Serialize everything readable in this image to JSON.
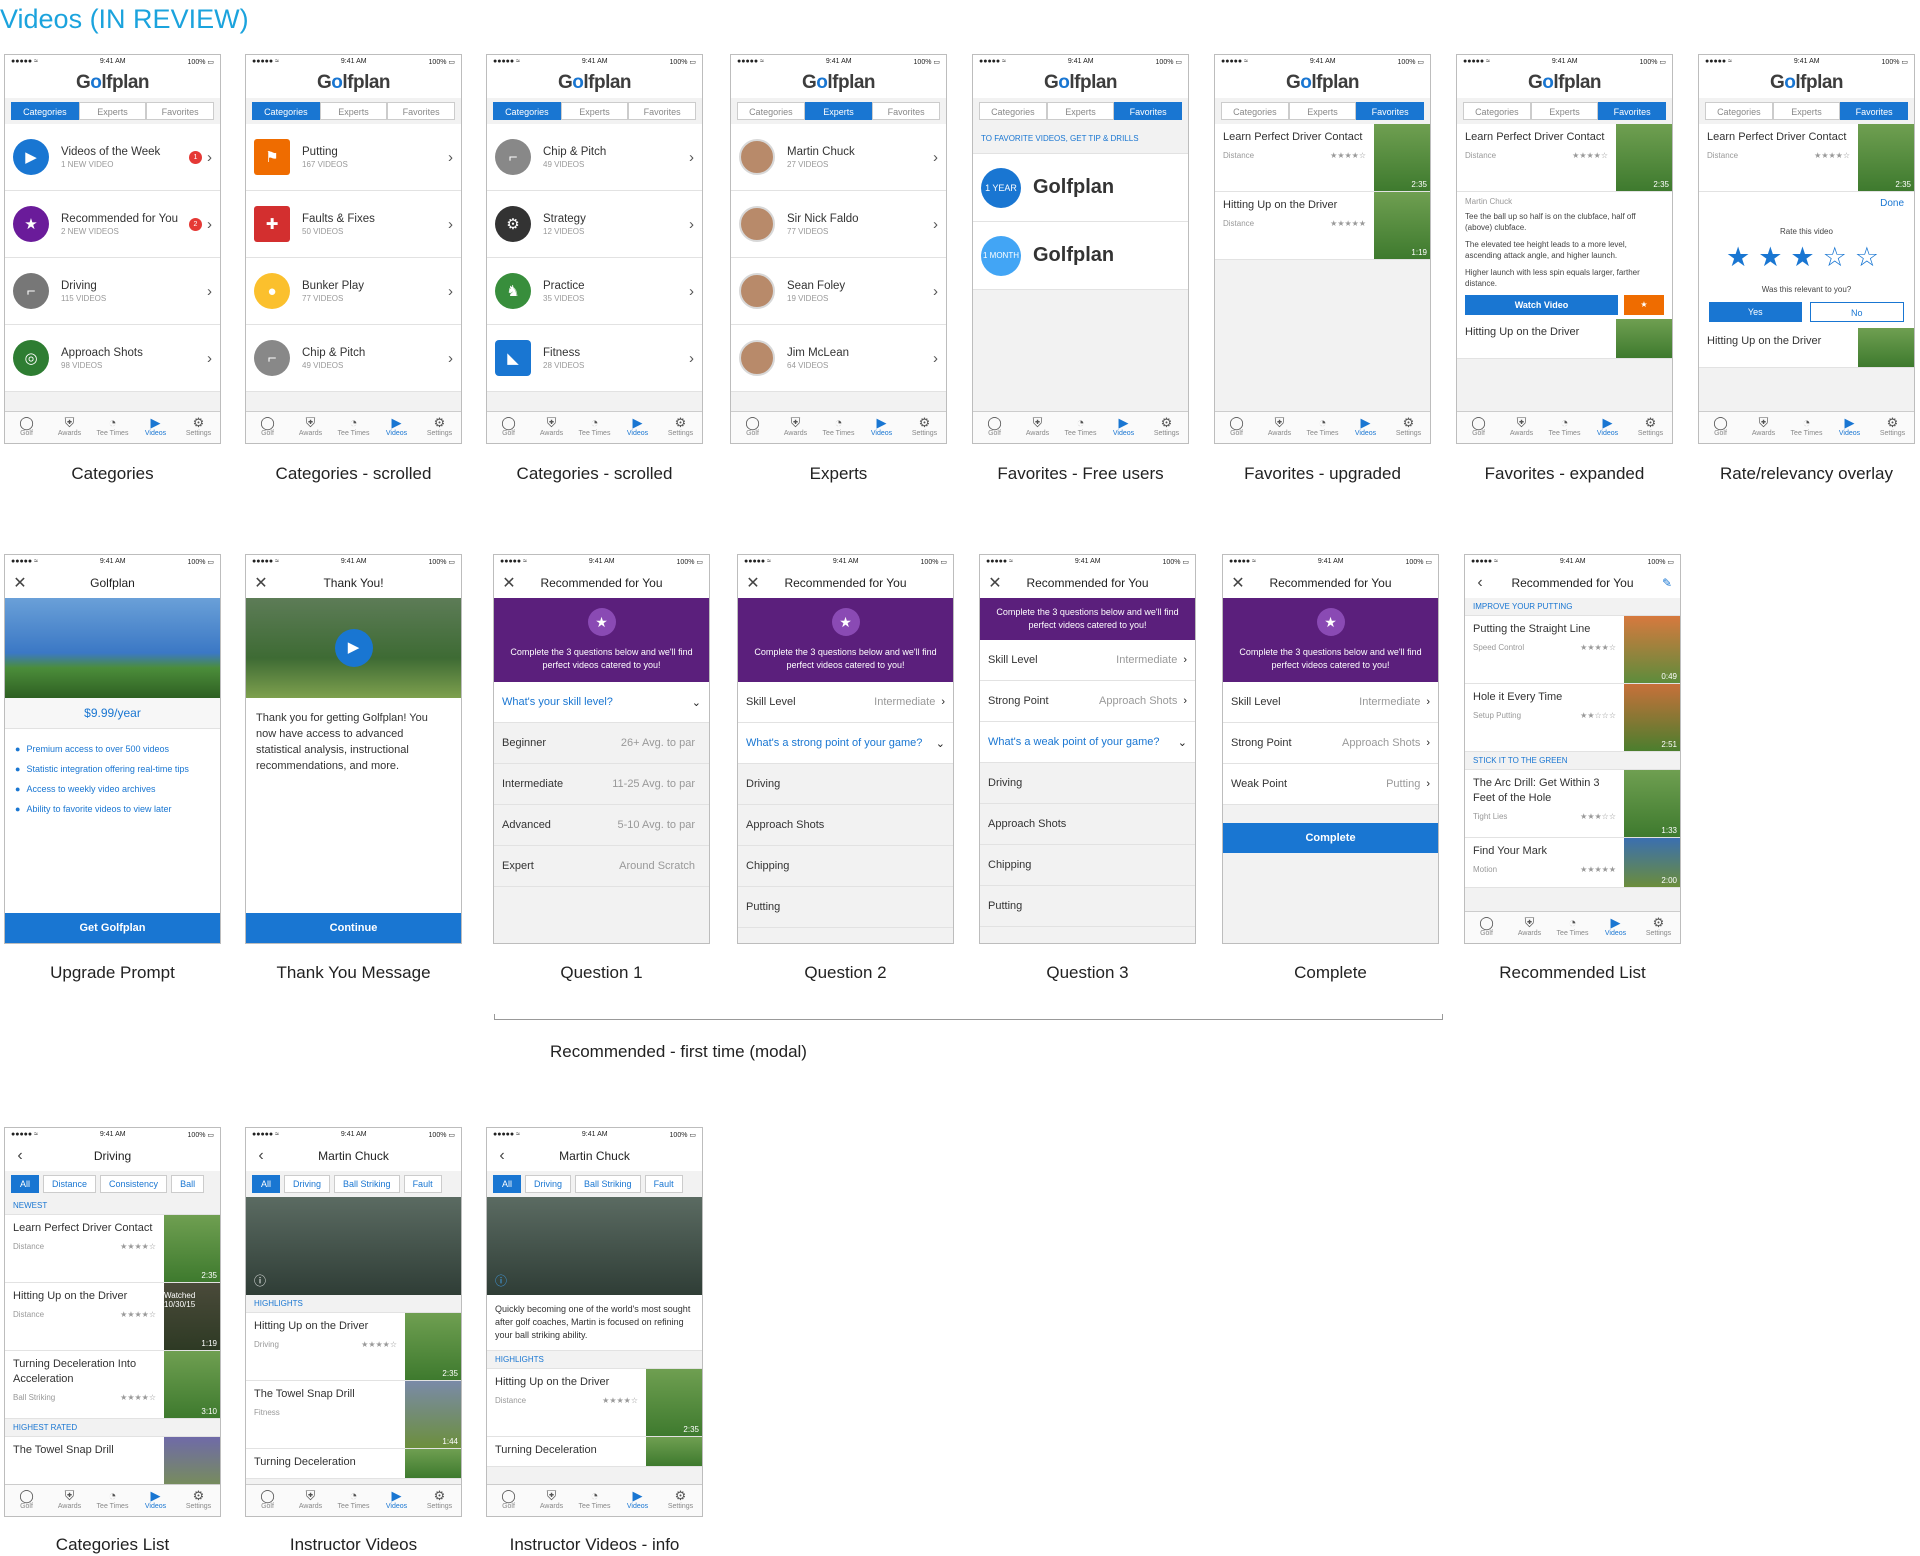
{
  "page_title": "Videos (IN REVIEW)",
  "bracket_label": "Recommended - first time (modal)",
  "common": {
    "time": "9:41 AM",
    "carrier": "●●●●● ≈",
    "battery": "100% ▭",
    "logo_a": "G",
    "logo_o": "o",
    "logo_b": "lfplan",
    "tabs": {
      "categories": "Categories",
      "experts": "Experts",
      "favorites": "Favorites"
    },
    "tabbar": [
      "Golf",
      "Awards",
      "Tee Times",
      "Videos",
      "Settings"
    ],
    "chev": "›"
  },
  "captions": {
    "s1": "Categories",
    "s2": "Categories - scrolled",
    "s3": "Categories - scrolled",
    "s4": "Experts",
    "s5": "Favorites - Free users",
    "s6": "Favorites - upgraded",
    "s7": "Favorites - expanded",
    "s8": "Rate/relevancy overlay",
    "s9": "Upgrade Prompt",
    "s10": "Thank You Message",
    "s11": "Question 1",
    "s12": "Question 2",
    "s13": "Question 3",
    "s14": "Complete",
    "s15": "Recommended List",
    "s16": "Categories List",
    "s17": "Instructor Videos",
    "s18": "Instructor Videos - info"
  },
  "categories": [
    {
      "title": "Videos of the Week",
      "sub": "1 NEW VIDEO",
      "badge": "1"
    },
    {
      "title": "Recommended for You",
      "sub": "2 NEW VIDEOS",
      "badge": "2"
    },
    {
      "title": "Driving",
      "sub": "115 VIDEOS"
    },
    {
      "title": "Approach Shots",
      "sub": "98 VIDEOS"
    }
  ],
  "categories2": [
    {
      "title": "Putting",
      "sub": "167 VIDEOS"
    },
    {
      "title": "Faults & Fixes",
      "sub": "50 VIDEOS"
    },
    {
      "title": "Bunker Play",
      "sub": "77 VIDEOS"
    },
    {
      "title": "Chip & Pitch",
      "sub": "49 VIDEOS"
    }
  ],
  "categories3": [
    {
      "title": "Chip & Pitch",
      "sub": "49 VIDEOS"
    },
    {
      "title": "Strategy",
      "sub": "12 VIDEOS"
    },
    {
      "title": "Practice",
      "sub": "35 VIDEOS"
    },
    {
      "title": "Fitness",
      "sub": "28 VIDEOS"
    }
  ],
  "experts": [
    {
      "title": "Martin Chuck",
      "sub": "27 VIDEOS"
    },
    {
      "title": "Sir Nick Faldo",
      "sub": "77 VIDEOS"
    },
    {
      "title": "Sean Foley",
      "sub": "19 VIDEOS"
    },
    {
      "title": "Jim McLean",
      "sub": "64 VIDEOS"
    }
  ],
  "favorites_free": {
    "prompt": "TO FAVORITE VIDEOS, GET TIP & DRILLS",
    "plan1": "1 YEAR",
    "plan2": "1 MONTH",
    "logo": "Golfplan"
  },
  "fav_videos": [
    {
      "title": "Learn Perfect Driver Contact",
      "tag": "Distance",
      "stars": "★★★★☆",
      "dur": "2:35"
    },
    {
      "title": "Hitting Up on the Driver",
      "tag": "Distance",
      "stars": "★★★★★",
      "dur": "1:19"
    }
  ],
  "expanded": {
    "instructor": "Martin Chuck",
    "p1": "Tee the ball up so half is on the clubface, half off (above) clubface.",
    "p2": "The elevated tee height leads to a more level, ascending attack angle, and higher launch.",
    "p3": "Higher launch with less spin equals larger, farther distance.",
    "watch": "Watch Video",
    "fav_star": "★"
  },
  "rating": {
    "done": "Done",
    "rate_label": "Rate this video",
    "stars": "★★★☆☆",
    "relevant": "Was this relevant to you?",
    "yes": "Yes",
    "no": "No"
  },
  "upgrade": {
    "header": "Golfplan",
    "price": "$9.99/year",
    "bullets": [
      "Premium access to over 500 videos",
      "Statistic integration offering real-time tips",
      "Access to weekly video archives",
      "Ability to favorite videos to view later"
    ],
    "cta": "Get Golfplan"
  },
  "thanks": {
    "header": "Thank You!",
    "body": "Thank you for getting Golfplan! You now have access to advanced statistical analysis, instructional recommendations, and more.",
    "cta": "Continue"
  },
  "recommend": {
    "header": "Recommended for You",
    "intro": "Complete the 3 questions below and we'll find perfect videos catered to you!",
    "q1": "What's your skill level?",
    "q2": "What's a strong point of your game?",
    "q3": "What's a weak point of your game?",
    "levels": [
      {
        "k": "Beginner",
        "v": "26+ Avg. to par"
      },
      {
        "k": "Intermediate",
        "v": "11-25 Avg. to par"
      },
      {
        "k": "Advanced",
        "v": "5-10 Avg. to par"
      },
      {
        "k": "Expert",
        "v": "Around Scratch"
      }
    ],
    "skill_label": "Skill Level",
    "skill_val": "Intermediate",
    "strong_label": "Strong Point",
    "strong_val": "Approach Shots",
    "weak_label": "Weak Point",
    "weak_val": "Putting",
    "areas": [
      "Driving",
      "Approach Shots",
      "Chipping",
      "Putting"
    ],
    "complete": "Complete"
  },
  "rec_list": {
    "header": "Recommended for You",
    "sec1": "IMPROVE YOUR PUTTING",
    "sec2": "STICK IT TO THE GREEN",
    "items": [
      {
        "title": "Putting the Straight Line",
        "tag": "Speed Control",
        "stars": "★★★★☆",
        "dur": "0:49"
      },
      {
        "title": "Hole it Every Time",
        "tag": "Setup Putting",
        "stars": "★★☆☆☆",
        "dur": "2:51"
      },
      {
        "title": "The Arc Drill: Get Within 3 Feet of the Hole",
        "tag": "Tight Lies",
        "stars": "★★★☆☆",
        "dur": "1:33"
      },
      {
        "title": "Find Your Mark",
        "tag": "Motion",
        "stars": "★★★★★",
        "dur": "2:00"
      }
    ]
  },
  "cat_list": {
    "header": "Driving",
    "chips": [
      "All",
      "Distance",
      "Consistency",
      "Ball"
    ],
    "sec1": "NEWEST",
    "sec2": "HIGHEST RATED",
    "watched": "Watched 10/30/15",
    "items": [
      {
        "title": "Learn Perfect Driver Contact",
        "tag": "Distance",
        "stars": "★★★★☆",
        "dur": "2:35"
      },
      {
        "title": "Hitting Up on the Driver",
        "tag": "Distance",
        "stars": "★★★★☆",
        "dur": "1:19"
      },
      {
        "title": "Turning Deceleration Into Acceleration",
        "tag": "Ball Striking",
        "stars": "★★★★☆",
        "dur": "3:10"
      },
      {
        "title": "The Towel Snap Drill",
        "tag": "",
        "stars": "",
        "dur": ""
      }
    ]
  },
  "instructor": {
    "header": "Martin Chuck",
    "chips": [
      "All",
      "Driving",
      "Ball Striking",
      "Fault"
    ],
    "sec": "HIGHLIGHTS",
    "info_icon": "ⓘ",
    "bio": "Quickly becoming one of the world's most sought after golf coaches, Martin is focused on refining your ball striking ability.",
    "items": [
      {
        "title": "Hitting Up on the Driver",
        "tag": "Driving",
        "stars": "★★★★☆",
        "dur": "2:35"
      },
      {
        "title": "The Towel Snap Drill",
        "tag": "Fitness",
        "stars": "",
        "dur": "1:44"
      },
      {
        "title": "Turning Deceleration",
        "tag": "",
        "stars": "",
        "dur": ""
      }
    ],
    "info_items": [
      {
        "title": "Hitting Up on the Driver",
        "tag": "Distance",
        "stars": "★★★★☆",
        "dur": "2:35"
      },
      {
        "title": "Turning Deceleration",
        "tag": "",
        "stars": "",
        "dur": ""
      }
    ]
  }
}
